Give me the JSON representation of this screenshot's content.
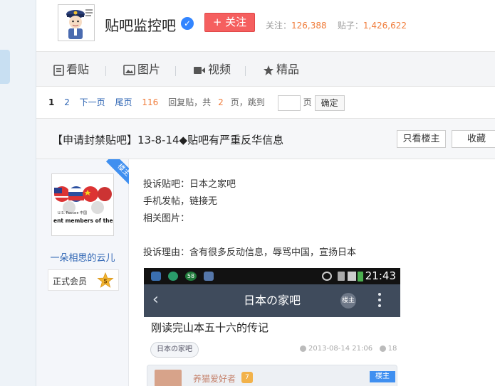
{
  "forum": {
    "name": "贴吧监控吧",
    "follow_label": "+ 关注",
    "follow_count_label": "关注：",
    "follow_count": "126,388",
    "post_count_label": "贴子：",
    "post_count": "1,426,622"
  },
  "nav": {
    "items": [
      {
        "label": "看贴",
        "icon": "document-icon"
      },
      {
        "label": "图片",
        "icon": "image-icon"
      },
      {
        "label": "视频",
        "icon": "video-icon"
      },
      {
        "label": "精品",
        "icon": "star-icon"
      }
    ]
  },
  "pager": {
    "current": "1",
    "page2": "2",
    "next": "下一页",
    "last": "尾页",
    "reply_count": "116",
    "reply_text": "回复贴，共",
    "total_pages": "2",
    "page_text": "页，跳到",
    "page_unit": "页",
    "go": "确定"
  },
  "thread": {
    "title": "【申请封禁贴吧】13-8-14◆贴吧有严重反华信息",
    "only_author": "只看楼主",
    "favorite": "收藏"
  },
  "author": {
    "badge": "楼主",
    "name": "一朵相思的云儿",
    "rank": "正式会员",
    "level": "5",
    "avatar_caption_1": "U.S. Россия 中国",
    "avatar_caption_2": "ent members of the U.N"
  },
  "post": {
    "line1": "投诉贴吧：日本之家吧",
    "line2": "手机发帖，链接无",
    "line3": "相关图片：",
    "line4": "投诉理由：含有很多反动信息，辱骂中国，宣扬日本"
  },
  "screenshot": {
    "time": "21:43",
    "signal_badge": "58",
    "bar_title": "日本の家吧",
    "badge": "楼主",
    "post_title": "刚读完山本五十六的传记",
    "tag": "日本の家吧",
    "date": "2013-08-14 21:06",
    "replies": "18",
    "reply_user": "养猫爱好者",
    "reply_level": "7",
    "reply_badge": "楼主"
  },
  "colors": {
    "follow": "#f55f5f",
    "accent_blue": "#2d64b3",
    "count_orange": "#f07c3a",
    "app_bar": "#3f4b5c"
  }
}
